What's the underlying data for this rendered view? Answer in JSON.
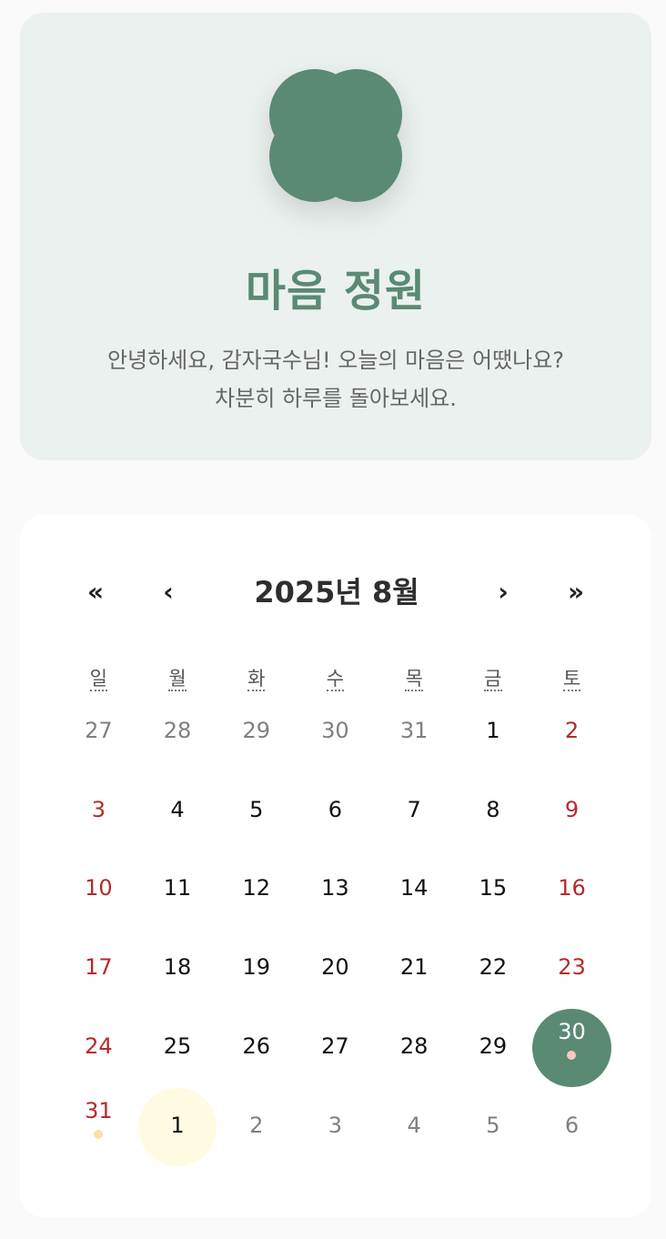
{
  "hero": {
    "title": "마음 정원",
    "greeting_line1": "안녕하세요, 감자국수님! 오늘의 마음은 어땠나요?",
    "greeting_line2": "차분히 하루를 돌아보세요.",
    "logo_icon": "clover-icon",
    "logo_color": "#5a8a74"
  },
  "calendar": {
    "month_title": "2025년 8월",
    "nav": {
      "prev_year": "«",
      "prev_month": "‹",
      "next_month": "›",
      "next_year": "»"
    },
    "weekdays": [
      "일",
      "월",
      "화",
      "수",
      "목",
      "금",
      "토"
    ],
    "weeks": [
      [
        {
          "day": "27",
          "type": "other"
        },
        {
          "day": "28",
          "type": "other"
        },
        {
          "day": "29",
          "type": "other"
        },
        {
          "day": "30",
          "type": "other"
        },
        {
          "day": "31",
          "type": "other"
        },
        {
          "day": "1",
          "type": "normal"
        },
        {
          "day": "2",
          "type": "weekend"
        }
      ],
      [
        {
          "day": "3",
          "type": "weekend"
        },
        {
          "day": "4",
          "type": "normal"
        },
        {
          "day": "5",
          "type": "normal"
        },
        {
          "day": "6",
          "type": "normal"
        },
        {
          "day": "7",
          "type": "normal"
        },
        {
          "day": "8",
          "type": "normal"
        },
        {
          "day": "9",
          "type": "weekend"
        }
      ],
      [
        {
          "day": "10",
          "type": "weekend"
        },
        {
          "day": "11",
          "type": "normal"
        },
        {
          "day": "12",
          "type": "normal"
        },
        {
          "day": "13",
          "type": "normal"
        },
        {
          "day": "14",
          "type": "normal"
        },
        {
          "day": "15",
          "type": "normal"
        },
        {
          "day": "16",
          "type": "weekend"
        }
      ],
      [
        {
          "day": "17",
          "type": "weekend"
        },
        {
          "day": "18",
          "type": "normal"
        },
        {
          "day": "19",
          "type": "normal"
        },
        {
          "day": "20",
          "type": "normal"
        },
        {
          "day": "21",
          "type": "normal"
        },
        {
          "day": "22",
          "type": "normal"
        },
        {
          "day": "23",
          "type": "weekend"
        }
      ],
      [
        {
          "day": "24",
          "type": "weekend"
        },
        {
          "day": "25",
          "type": "normal"
        },
        {
          "day": "26",
          "type": "normal"
        },
        {
          "day": "27",
          "type": "normal"
        },
        {
          "day": "28",
          "type": "normal"
        },
        {
          "day": "29",
          "type": "normal"
        },
        {
          "day": "30",
          "type": "selected",
          "dot": "#f4c9c4"
        }
      ],
      [
        {
          "day": "31",
          "type": "weekend",
          "dot": "#f8e1a8"
        },
        {
          "day": "1",
          "type": "today"
        },
        {
          "day": "2",
          "type": "other"
        },
        {
          "day": "3",
          "type": "other"
        },
        {
          "day": "4",
          "type": "other"
        },
        {
          "day": "5",
          "type": "other"
        },
        {
          "day": "6",
          "type": "other"
        }
      ]
    ]
  }
}
